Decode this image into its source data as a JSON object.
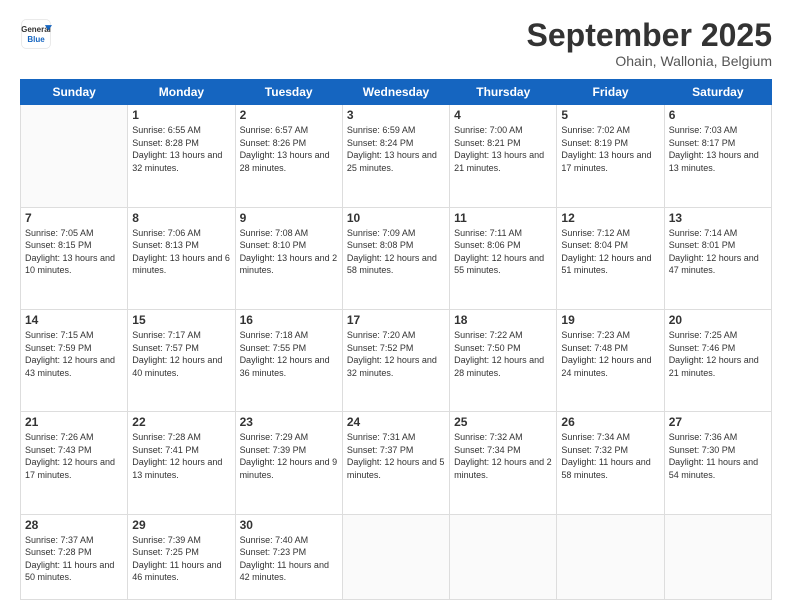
{
  "logo": {
    "general": "General",
    "blue": "Blue"
  },
  "header": {
    "month": "September 2025",
    "location": "Ohain, Wallonia, Belgium"
  },
  "days": [
    "Sunday",
    "Monday",
    "Tuesday",
    "Wednesday",
    "Thursday",
    "Friday",
    "Saturday"
  ],
  "weeks": [
    [
      {
        "day": "",
        "info": ""
      },
      {
        "day": "1",
        "info": "Sunrise: 6:55 AM\nSunset: 8:28 PM\nDaylight: 13 hours and 32 minutes."
      },
      {
        "day": "2",
        "info": "Sunrise: 6:57 AM\nSunset: 8:26 PM\nDaylight: 13 hours and 28 minutes."
      },
      {
        "day": "3",
        "info": "Sunrise: 6:59 AM\nSunset: 8:24 PM\nDaylight: 13 hours and 25 minutes."
      },
      {
        "day": "4",
        "info": "Sunrise: 7:00 AM\nSunset: 8:21 PM\nDaylight: 13 hours and 21 minutes."
      },
      {
        "day": "5",
        "info": "Sunrise: 7:02 AM\nSunset: 8:19 PM\nDaylight: 13 hours and 17 minutes."
      },
      {
        "day": "6",
        "info": "Sunrise: 7:03 AM\nSunset: 8:17 PM\nDaylight: 13 hours and 13 minutes."
      }
    ],
    [
      {
        "day": "7",
        "info": "Sunrise: 7:05 AM\nSunset: 8:15 PM\nDaylight: 13 hours and 10 minutes."
      },
      {
        "day": "8",
        "info": "Sunrise: 7:06 AM\nSunset: 8:13 PM\nDaylight: 13 hours and 6 minutes."
      },
      {
        "day": "9",
        "info": "Sunrise: 7:08 AM\nSunset: 8:10 PM\nDaylight: 13 hours and 2 minutes."
      },
      {
        "day": "10",
        "info": "Sunrise: 7:09 AM\nSunset: 8:08 PM\nDaylight: 12 hours and 58 minutes."
      },
      {
        "day": "11",
        "info": "Sunrise: 7:11 AM\nSunset: 8:06 PM\nDaylight: 12 hours and 55 minutes."
      },
      {
        "day": "12",
        "info": "Sunrise: 7:12 AM\nSunset: 8:04 PM\nDaylight: 12 hours and 51 minutes."
      },
      {
        "day": "13",
        "info": "Sunrise: 7:14 AM\nSunset: 8:01 PM\nDaylight: 12 hours and 47 minutes."
      }
    ],
    [
      {
        "day": "14",
        "info": "Sunrise: 7:15 AM\nSunset: 7:59 PM\nDaylight: 12 hours and 43 minutes."
      },
      {
        "day": "15",
        "info": "Sunrise: 7:17 AM\nSunset: 7:57 PM\nDaylight: 12 hours and 40 minutes."
      },
      {
        "day": "16",
        "info": "Sunrise: 7:18 AM\nSunset: 7:55 PM\nDaylight: 12 hours and 36 minutes."
      },
      {
        "day": "17",
        "info": "Sunrise: 7:20 AM\nSunset: 7:52 PM\nDaylight: 12 hours and 32 minutes."
      },
      {
        "day": "18",
        "info": "Sunrise: 7:22 AM\nSunset: 7:50 PM\nDaylight: 12 hours and 28 minutes."
      },
      {
        "day": "19",
        "info": "Sunrise: 7:23 AM\nSunset: 7:48 PM\nDaylight: 12 hours and 24 minutes."
      },
      {
        "day": "20",
        "info": "Sunrise: 7:25 AM\nSunset: 7:46 PM\nDaylight: 12 hours and 21 minutes."
      }
    ],
    [
      {
        "day": "21",
        "info": "Sunrise: 7:26 AM\nSunset: 7:43 PM\nDaylight: 12 hours and 17 minutes."
      },
      {
        "day": "22",
        "info": "Sunrise: 7:28 AM\nSunset: 7:41 PM\nDaylight: 12 hours and 13 minutes."
      },
      {
        "day": "23",
        "info": "Sunrise: 7:29 AM\nSunset: 7:39 PM\nDaylight: 12 hours and 9 minutes."
      },
      {
        "day": "24",
        "info": "Sunrise: 7:31 AM\nSunset: 7:37 PM\nDaylight: 12 hours and 5 minutes."
      },
      {
        "day": "25",
        "info": "Sunrise: 7:32 AM\nSunset: 7:34 PM\nDaylight: 12 hours and 2 minutes."
      },
      {
        "day": "26",
        "info": "Sunrise: 7:34 AM\nSunset: 7:32 PM\nDaylight: 11 hours and 58 minutes."
      },
      {
        "day": "27",
        "info": "Sunrise: 7:36 AM\nSunset: 7:30 PM\nDaylight: 11 hours and 54 minutes."
      }
    ],
    [
      {
        "day": "28",
        "info": "Sunrise: 7:37 AM\nSunset: 7:28 PM\nDaylight: 11 hours and 50 minutes."
      },
      {
        "day": "29",
        "info": "Sunrise: 7:39 AM\nSunset: 7:25 PM\nDaylight: 11 hours and 46 minutes."
      },
      {
        "day": "30",
        "info": "Sunrise: 7:40 AM\nSunset: 7:23 PM\nDaylight: 11 hours and 42 minutes."
      },
      {
        "day": "",
        "info": ""
      },
      {
        "day": "",
        "info": ""
      },
      {
        "day": "",
        "info": ""
      },
      {
        "day": "",
        "info": ""
      }
    ]
  ]
}
